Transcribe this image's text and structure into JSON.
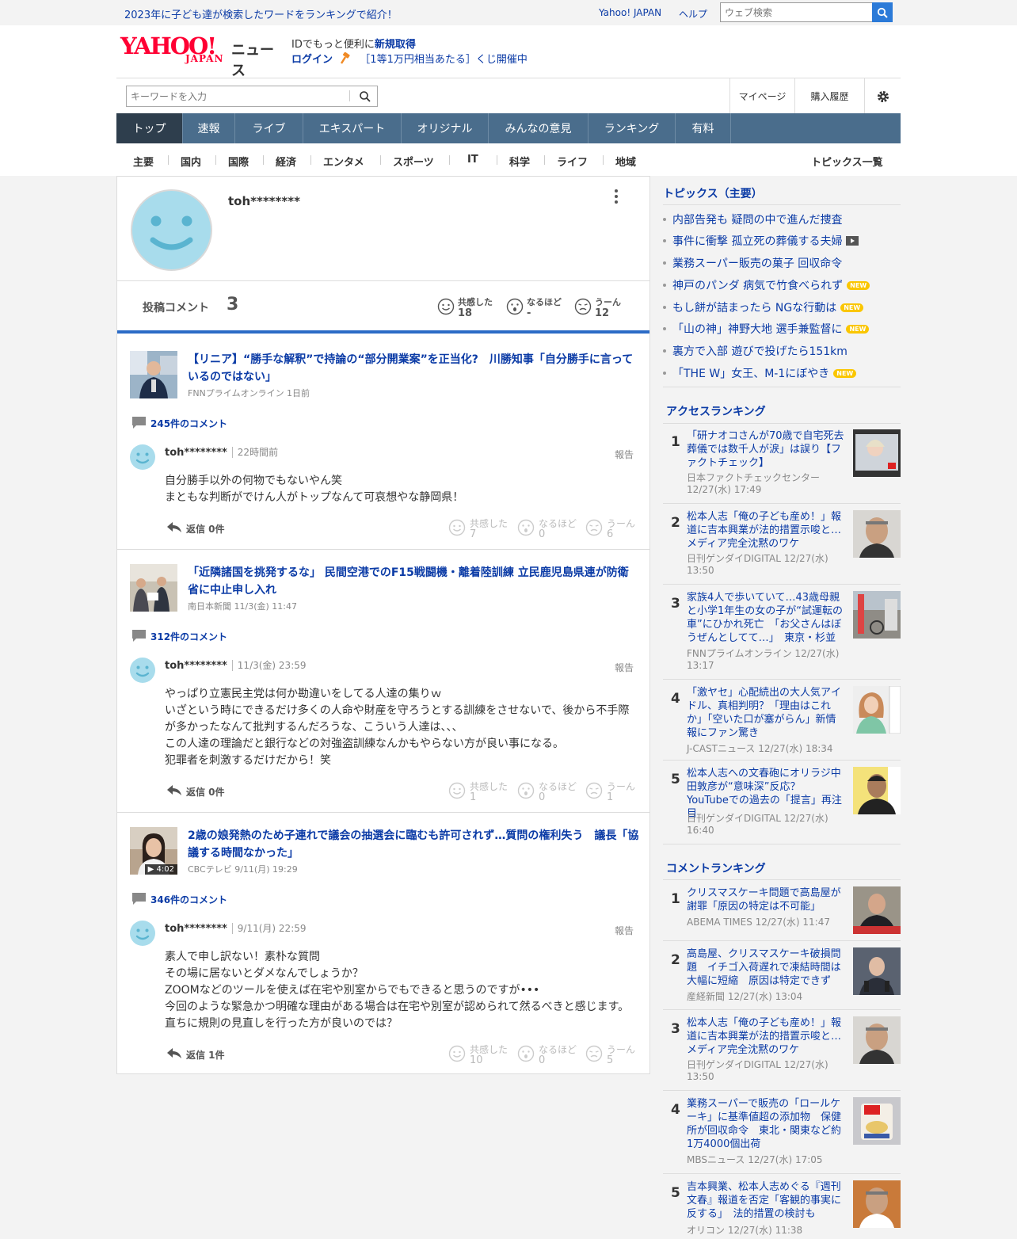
{
  "header": {
    "promo": "2023年に子ども達が検索したワードをランキングで紹介！",
    "yahoo_japan_link": "Yahoo! JAPAN",
    "help_link": "ヘルプ",
    "web_search_placeholder": "ウェブ検索",
    "logo_main": "YAHOO!",
    "logo_sub": "JAPAN",
    "logo_news": "ニュース",
    "id_promo_text": "IDでもっと便利に",
    "id_promo_link": "新規取得",
    "login_link": "ログイン",
    "lottery_text": "［1等1万円相当あたる］くじ開催中"
  },
  "toolbar": {
    "keyword_placeholder": "キーワードを入力",
    "mypage": "マイページ",
    "purchase_history": "購入履歴"
  },
  "global_nav": [
    "トップ",
    "速報",
    "ライブ",
    "エキスパート",
    "オリジナル",
    "みんなの意見",
    "ランキング",
    "有料"
  ],
  "sub_nav": [
    "主要",
    "国内",
    "国際",
    "経済",
    "エンタメ",
    "スポーツ",
    "IT",
    "科学",
    "ライフ",
    "地域"
  ],
  "sub_nav_topics_link": "トピックス一覧",
  "profile": {
    "username": "toh********",
    "posted_comments_label": "投稿コメント",
    "posted_comments_count": "3",
    "reactions": [
      {
        "label": "共感した",
        "value": "18"
      },
      {
        "label": "なるほど",
        "value": "-"
      },
      {
        "label": "うーん",
        "value": "12"
      }
    ]
  },
  "comments": [
    {
      "article_title": "【リニア】“勝手な解釈”で持論の“部分開業案”を正当化?　川勝知事「自分勝手に言っているのではない」",
      "source": "FNNプライムオンライン 1日前",
      "comment_count": "245件のコメント",
      "user": "toh********",
      "time": "22時間前",
      "report": "報告",
      "lines": [
        "自分勝手以外の何物でもないやん笑",
        "まともな判断がでけん人がトップなんて可哀想やな静岡県！"
      ],
      "reply": "返信 0件",
      "reactions": [
        {
          "label": "共感した",
          "value": "7"
        },
        {
          "label": "なるほど",
          "value": "0"
        },
        {
          "label": "うーん",
          "value": "6"
        }
      ]
    },
    {
      "article_title": "「近隣諸国を挑発するな」 民間空港でのF15戦闘機・離着陸訓練 立民鹿児島県連が防衛省に中止申し入れ",
      "source": "南日本新聞 11/3(金) 11:47",
      "comment_count": "312件のコメント",
      "user": "toh********",
      "time": "11/3(金) 23:59",
      "report": "報告",
      "lines": [
        "やっぱり立憲民主党は何か勘違いをしてる人達の集りｗ",
        "いざという時にできるだけ多くの人命や財産を守ろうとする訓練をさせないで、後から不手際が多かったなんて批判するんだろうな、こういう人達は、、、",
        "この人達の理論だと銀行などの対強盗訓練なんかもやらない方が良い事になる。",
        "犯罪者を刺激するだけだから！笑"
      ],
      "reply": "返信 0件",
      "reactions": [
        {
          "label": "共感した",
          "value": "1"
        },
        {
          "label": "なるほど",
          "value": "0"
        },
        {
          "label": "うーん",
          "value": "1"
        }
      ]
    },
    {
      "article_title": "2歳の娘発熱のため子連れで議会の抽選会に臨むも許可されず…質問の権利失う　議長「協議する時間なかった」",
      "source": "CBCテレビ 9/11(月) 19:29",
      "video_duration": "▶ 4:02",
      "comment_count": "346件のコメント",
      "user": "toh********",
      "time": "9/11(月) 22:59",
      "report": "報告",
      "lines": [
        "素人で申し訳ない！素朴な質問",
        "その場に居ないとダメなんでしょうか？",
        "ZOOMなどのツールを使えば在宅や別室からでもできると思うのですが•••",
        "今回のような緊急かつ明確な理由がある場合は在宅や別室が認められて然るべきと感じます。",
        "直ちに規則の見直しを行った方が良いのでは？"
      ],
      "reply": "返信 1件",
      "reactions": [
        {
          "label": "共感した",
          "value": "10"
        },
        {
          "label": "なるほど",
          "value": "0"
        },
        {
          "label": "うーん",
          "value": "5"
        }
      ]
    }
  ],
  "sidebar": {
    "topics_title": "トピックス（主要）",
    "topics": [
      {
        "text": "内部告発も 疑問の中で進んだ捜査",
        "badge": ""
      },
      {
        "text": "事件に衝撃 孤立死の葬儀する夫婦",
        "badge": "video"
      },
      {
        "text": "業務スーパー販売の菓子 回収命令",
        "badge": ""
      },
      {
        "text": "神戸のパンダ 病気で竹食べられず",
        "badge": "NEW"
      },
      {
        "text": "もし餅が詰まったら NGな行動は",
        "badge": "NEW"
      },
      {
        "text": "「山の神」神野大地 選手兼監督に",
        "badge": "NEW"
      },
      {
        "text": "裏方で入部 遊びで投げたら151km",
        "badge": ""
      },
      {
        "text": "「THE W」女王、M-1にぼやき",
        "badge": "NEW"
      }
    ],
    "access_ranking_title": "アクセスランキング",
    "access_ranking": [
      {
        "rank": "1",
        "title": "「研ナオコさんが70歳で自宅死去 葬儀では数千人が涙」は誤り【ファクトチェック】",
        "meta": "日本ファクトチェックセンター 12/27(水) 17:49"
      },
      {
        "rank": "2",
        "title": "松本人志「俺の子ども産め！」報道に吉本興業が法的措置示唆と…メディア完全沈黙のワケ",
        "meta": "日刊ゲンダイDIGITAL 12/27(水) 13:50"
      },
      {
        "rank": "3",
        "title": "家族4人で歩いていて…43歳母親と小学1年生の女の子が“試運転の車”にひかれ死亡　「お父さんはぼうぜんとしてて…」　東京・杉並",
        "meta": "FNNプライムオンライン 12/27(水) 13:17"
      },
      {
        "rank": "4",
        "title": "「激ヤセ」心配続出の大人気アイドル、真相判明？「理由はこれか」「空いた口が塞がらん」新情報にファン驚き",
        "meta": "J-CASTニュース 12/27(水) 18:34"
      },
      {
        "rank": "5",
        "title": "松本人志への文春砲にオリラジ中田敦彦が“意味深”反応？ YouTubeでの過去の「提言」再注目",
        "meta": "日刊ゲンダイDIGITAL 12/27(水) 16:40"
      }
    ],
    "comment_ranking_title": "コメントランキング",
    "comment_ranking": [
      {
        "rank": "1",
        "title": "クリスマスケーキ問題で高島屋が謝罪「原因の特定は不可能」",
        "meta": "ABEMA TIMES 12/27(水) 11:47"
      },
      {
        "rank": "2",
        "title": "高島屋、クリスマスケーキ破損問題　イチゴ入荷遅れで凍結時間は大幅に短縮　原因は特定できず",
        "meta": "産経新聞 12/27(水) 13:04"
      },
      {
        "rank": "3",
        "title": "松本人志「俺の子ども産め！」報道に吉本興業が法的措置示唆と…メディア完全沈黙のワケ",
        "meta": "日刊ゲンダイDIGITAL 12/27(水) 13:50"
      },
      {
        "rank": "4",
        "title": "業務スーパーで販売の「ロールケーキ」に基準値超の添加物　保健所が回収命令　東北・関東など約1万4000個出荷",
        "meta": "MBSニュース 12/27(水) 17:05"
      },
      {
        "rank": "5",
        "title": "吉本興業、松本人志めぐる『週刊文春』報道を否定「客観的事実に反する」　法的措置の検討も",
        "meta": "オリコン 12/27(水) 11:38"
      }
    ]
  }
}
